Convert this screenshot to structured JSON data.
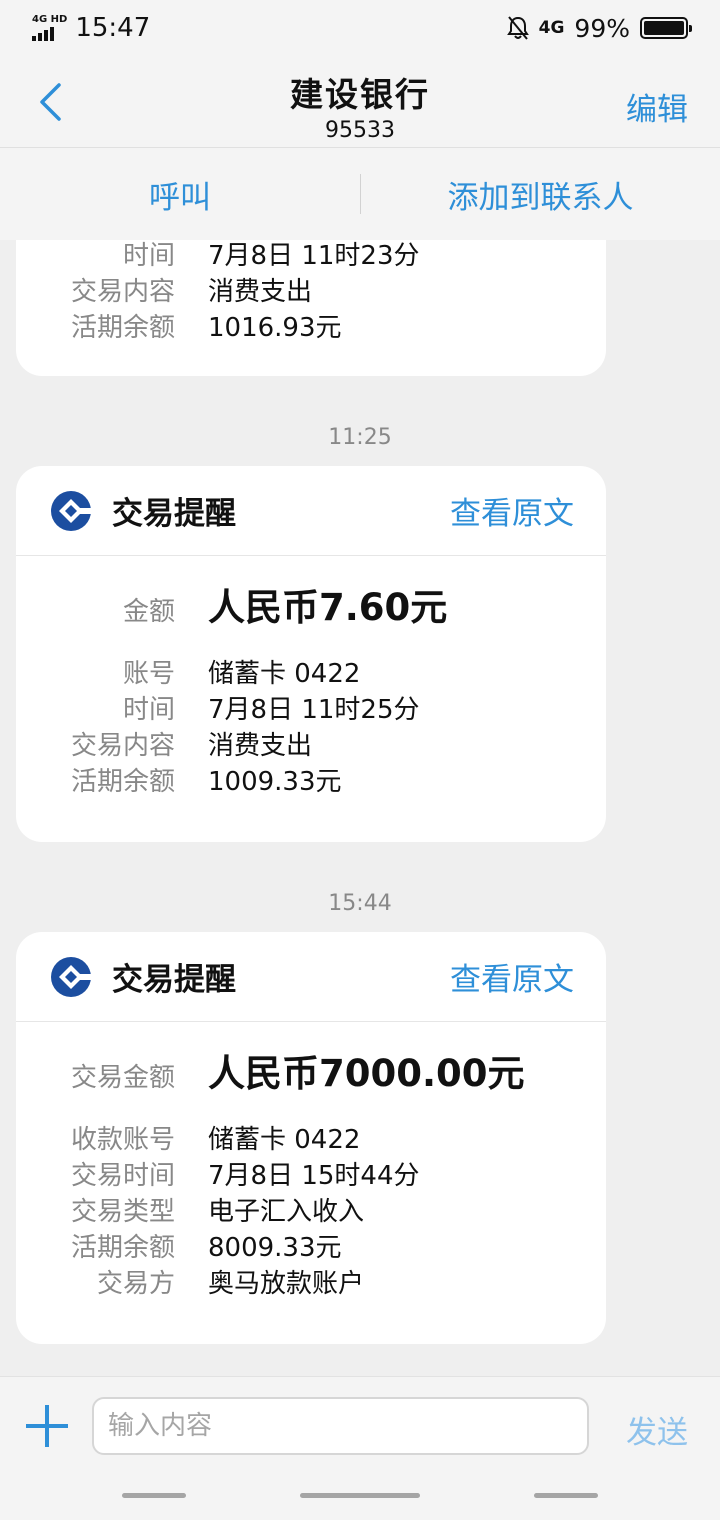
{
  "status_bar": {
    "network_type": "4G HD",
    "time": "15:47",
    "mobile_data": "4G",
    "battery": "99%",
    "battery_level": 0.99
  },
  "header": {
    "back_icon": "chevron-left-icon",
    "title": "建设银行",
    "number": "95533",
    "edit_label": "编辑"
  },
  "actions": {
    "call_label": "呼叫",
    "add_contact_label": "添加到联系人"
  },
  "messages": [
    {
      "rows": [
        {
          "label": "时间",
          "value": "7月8日 11时23分"
        },
        {
          "label": "交易内容",
          "value": "消费支出"
        },
        {
          "label": "活期余额",
          "value": "1016.93元"
        }
      ]
    },
    {
      "timestamp": "11:25",
      "title": "交易提醒",
      "view_original": "查看原文",
      "amount_label": "金额",
      "amount": "人民币7.60元",
      "rows": [
        {
          "label": "账号",
          "value": "储蓄卡 0422"
        },
        {
          "label": "时间",
          "value": "7月8日 11时25分"
        },
        {
          "label": "交易内容",
          "value": "消费支出"
        },
        {
          "label": "活期余额",
          "value": "1009.33元"
        }
      ]
    },
    {
      "timestamp": "15:44",
      "title": "交易提醒",
      "view_original": "查看原文",
      "amount_label": "交易金额",
      "amount": "人民币7000.00元",
      "rows": [
        {
          "label": "收款账号",
          "value": "储蓄卡 0422"
        },
        {
          "label": "交易时间",
          "value": "7月8日 15时44分"
        },
        {
          "label": "交易类型",
          "value": "电子汇入收入"
        },
        {
          "label": "活期余额",
          "value": "8009.33元"
        },
        {
          "label": "交易方",
          "value": "奥马放款账户"
        }
      ]
    }
  ],
  "input_bar": {
    "add_icon": "plus-icon",
    "placeholder": "输入内容",
    "send_label": "发送"
  },
  "colors": {
    "accent": "#2e8fd8",
    "send_disabled": "#8ec2ec",
    "ccb_blue": "#1c4ea0",
    "background": "#efefef"
  }
}
